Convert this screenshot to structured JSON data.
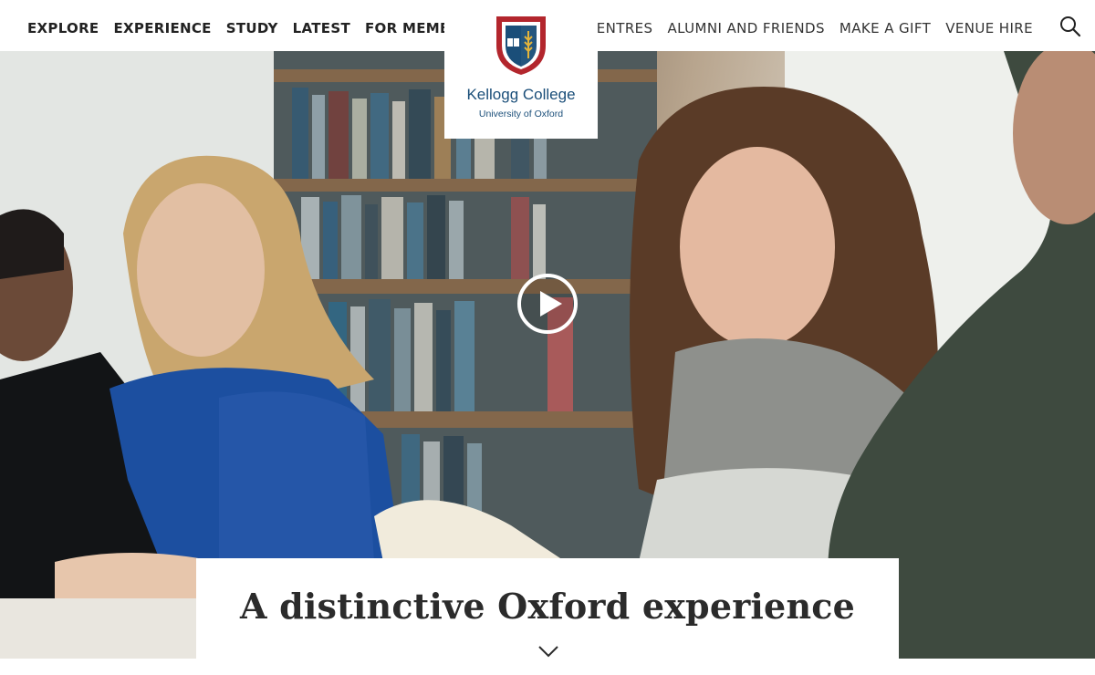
{
  "header": {
    "nav_left": [
      "EXPLORE",
      "EXPERIENCE",
      "STUDY",
      "LATEST",
      "FOR MEMBERS"
    ],
    "nav_right": [
      "CENTRES",
      "ALUMNI AND FRIENDS",
      "MAKE A GIFT",
      "VENUE HIRE"
    ],
    "search_icon": "search-icon"
  },
  "logo": {
    "name": "Kellogg College",
    "subtitle": "University of Oxford",
    "crest_icon": "college-crest-icon"
  },
  "hero": {
    "play_icon": "play-icon",
    "title": "A distinctive Oxford experience",
    "scroll_icon": "chevron-down-icon"
  },
  "colors": {
    "brand_blue": "#1a4e79",
    "crest_red": "#b3262d",
    "title_text": "#2b2b2b"
  }
}
